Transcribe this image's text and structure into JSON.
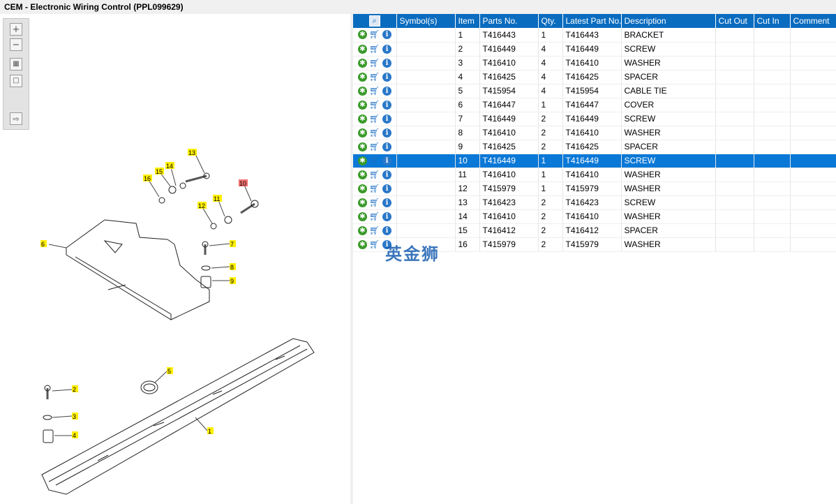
{
  "window": {
    "title": "CEM - Electronic Wiring Control (PPL099629)"
  },
  "toolbar": {
    "zoom_in": "zoom-in-icon",
    "zoom_out": "zoom-out-icon",
    "fit": "fit-icon",
    "actual": "actual-size-icon",
    "export": "export-icon"
  },
  "diagram": {
    "callouts": [
      "13",
      "14",
      "15",
      "16",
      "10",
      "11",
      "12",
      "6",
      "7",
      "8",
      "9",
      "5",
      "2",
      "3",
      "4",
      "1"
    ],
    "highlighted": "10"
  },
  "table": {
    "headers": [
      "",
      "Symbol(s)",
      "Item",
      "Parts No.",
      "Qty.",
      "Latest Part No.",
      "Description",
      "Cut Out",
      "Cut In",
      "Comment"
    ],
    "selected_item": "10",
    "rows": [
      {
        "item": "1",
        "part": "T416443",
        "qty": "1",
        "latest": "T416443",
        "desc": "BRACKET"
      },
      {
        "item": "2",
        "part": "T416449",
        "qty": "4",
        "latest": "T416449",
        "desc": "SCREW"
      },
      {
        "item": "3",
        "part": "T416410",
        "qty": "4",
        "latest": "T416410",
        "desc": "WASHER"
      },
      {
        "item": "4",
        "part": "T416425",
        "qty": "4",
        "latest": "T416425",
        "desc": "SPACER"
      },
      {
        "item": "5",
        "part": "T415954",
        "qty": "4",
        "latest": "T415954",
        "desc": "CABLE TIE"
      },
      {
        "item": "6",
        "part": "T416447",
        "qty": "1",
        "latest": "T416447",
        "desc": "COVER"
      },
      {
        "item": "7",
        "part": "T416449",
        "qty": "2",
        "latest": "T416449",
        "desc": "SCREW"
      },
      {
        "item": "8",
        "part": "T416410",
        "qty": "2",
        "latest": "T416410",
        "desc": "WASHER"
      },
      {
        "item": "9",
        "part": "T416425",
        "qty": "2",
        "latest": "T416425",
        "desc": "SPACER"
      },
      {
        "item": "10",
        "part": "T416449",
        "qty": "1",
        "latest": "T416449",
        "desc": "SCREW"
      },
      {
        "item": "11",
        "part": "T416410",
        "qty": "1",
        "latest": "T416410",
        "desc": "WASHER"
      },
      {
        "item": "12",
        "part": "T415979",
        "qty": "1",
        "latest": "T415979",
        "desc": "WASHER"
      },
      {
        "item": "13",
        "part": "T416423",
        "qty": "2",
        "latest": "T416423",
        "desc": "SCREW"
      },
      {
        "item": "14",
        "part": "T416410",
        "qty": "2",
        "latest": "T416410",
        "desc": "WASHER"
      },
      {
        "item": "15",
        "part": "T416412",
        "qty": "2",
        "latest": "T416412",
        "desc": "SPACER"
      },
      {
        "item": "16",
        "part": "T415979",
        "qty": "2",
        "latest": "T415979",
        "desc": "WASHER"
      }
    ]
  },
  "watermark": "英金狮",
  "colors": {
    "header": "#0a6cbf",
    "selected": "#0a78d7",
    "callout": "#ffef00",
    "callout_active": "#f07070"
  }
}
